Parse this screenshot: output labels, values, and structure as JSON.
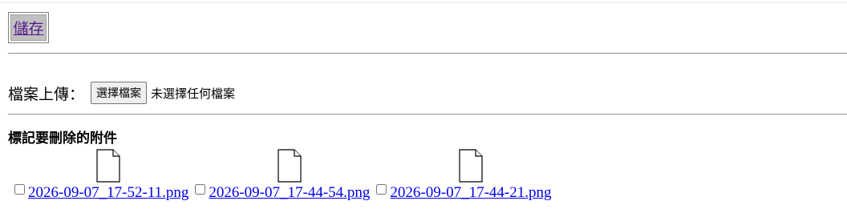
{
  "toolbar": {
    "save_label": "儲存"
  },
  "upload": {
    "label": "檔案上傳：",
    "button_label": "選擇檔案",
    "status_text": "未選擇任何檔案"
  },
  "attachments_section": {
    "heading": "標記要刪除的附件",
    "items": [
      {
        "filename": "2026-09-07_17-52-11.png",
        "checked": false,
        "icon": "file-icon"
      },
      {
        "filename": "2026-09-07_17-44-54.png",
        "checked": false,
        "icon": "file-icon"
      },
      {
        "filename": "2026-09-07_17-44-21.png",
        "checked": false,
        "icon": "file-icon"
      }
    ]
  },
  "colors": {
    "visited_link": "#551a8b",
    "link": "#0000ee",
    "save_background": "#c0c0c0"
  }
}
